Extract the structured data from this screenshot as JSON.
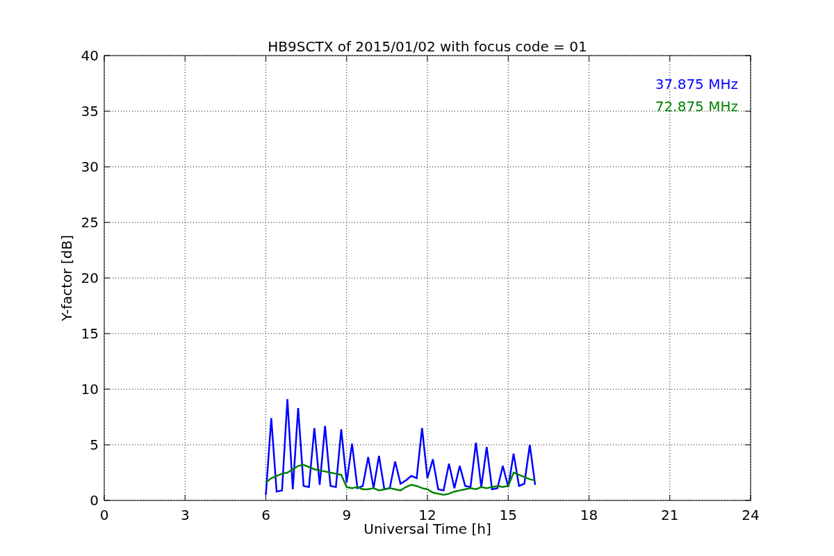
{
  "chart_data": {
    "type": "line",
    "grid": true,
    "title": "HB9SCTX of 2015/01/02 with focus code = 01",
    "xlabel": "Universal Time [h]",
    "ylabel": "Y-factor [dB]",
    "x": [
      6.0,
      6.2,
      6.4,
      6.6,
      6.8,
      7.0,
      7.2,
      7.4,
      7.6,
      7.8,
      8.0,
      8.2,
      8.4,
      8.6,
      8.8,
      9.0,
      9.2,
      9.4,
      9.6,
      9.8,
      10.0,
      10.2,
      10.4,
      10.6,
      10.8,
      11.0,
      11.2,
      11.4,
      11.6,
      11.8,
      12.0,
      12.2,
      12.4,
      12.6,
      12.8,
      13.0,
      13.2,
      13.4,
      13.6,
      13.8,
      14.0,
      14.2,
      14.4,
      14.6,
      14.8,
      15.0,
      15.2,
      15.4,
      15.6,
      15.8,
      16.0
    ],
    "series": [
      {
        "name": "37.875 MHz",
        "color": "#0000ff",
        "values": [
          0.5,
          7.4,
          0.8,
          0.9,
          9.1,
          1.0,
          8.3,
          1.3,
          1.2,
          6.5,
          1.4,
          6.7,
          1.3,
          1.2,
          6.4,
          1.6,
          5.1,
          1.1,
          1.3,
          3.9,
          1.1,
          4.0,
          1.0,
          1.1,
          3.5,
          1.5,
          1.8,
          2.2,
          2.0,
          6.5,
          2.0,
          3.7,
          1.0,
          0.9,
          3.3,
          1.1,
          3.1,
          1.3,
          1.2,
          5.2,
          1.2,
          4.8,
          1.0,
          1.1,
          3.1,
          1.2,
          4.2,
          1.3,
          1.5,
          5.0,
          1.4
        ]
      },
      {
        "name": "72.875 MHz",
        "color": "#008000",
        "values": [
          1.6,
          2.0,
          2.2,
          2.4,
          2.5,
          2.8,
          3.1,
          3.2,
          3.0,
          2.8,
          2.7,
          2.6,
          2.5,
          2.4,
          2.3,
          1.2,
          1.1,
          1.2,
          1.0,
          1.0,
          1.1,
          0.9,
          1.0,
          1.1,
          1.0,
          0.9,
          1.2,
          1.4,
          1.3,
          1.1,
          1.0,
          0.7,
          0.6,
          0.5,
          0.6,
          0.8,
          0.9,
          1.0,
          1.1,
          1.0,
          1.2,
          1.1,
          1.2,
          1.3,
          1.2,
          1.3,
          2.5,
          2.3,
          2.1,
          1.9,
          1.8
        ]
      }
    ],
    "xlim": [
      0,
      24
    ],
    "ylim": [
      0,
      40
    ],
    "xticks": [
      0,
      3,
      6,
      9,
      12,
      15,
      18,
      21,
      24
    ],
    "yticks": [
      0,
      5,
      10,
      15,
      20,
      25,
      30,
      35,
      40
    ]
  }
}
